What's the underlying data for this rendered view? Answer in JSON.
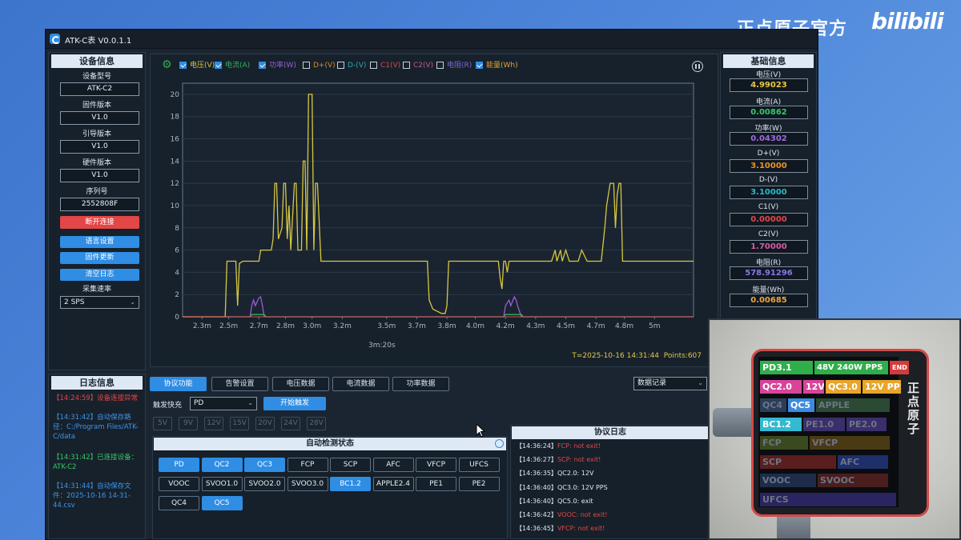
{
  "colors": {
    "voltage": "#d6c742",
    "current": "#2fb35a",
    "power": "#9b5bd9",
    "accent": "#2f8de4",
    "danger": "#e34646"
  },
  "window": {
    "title": "ATK-C表 V0.0.1.1"
  },
  "device_info": {
    "header": "设备信息",
    "fields": [
      {
        "label": "设备型号",
        "value": "ATK-C2"
      },
      {
        "label": "固件版本",
        "value": "V1.0"
      },
      {
        "label": "引导版本",
        "value": "V1.0"
      },
      {
        "label": "硬件版本",
        "value": "V1.0"
      },
      {
        "label": "序列号",
        "value": "2552808F"
      }
    ],
    "disconnect_label": "断开连接",
    "language_label": "语言设置",
    "firmware_update_label": "固件更新",
    "clear_log_label": "清空日志",
    "rate_label": "采集速率",
    "rate_value": "2 SPS"
  },
  "legend": [
    {
      "label": "电压(V)",
      "checked": true,
      "color": "#d6c742"
    },
    {
      "label": "电流(A)",
      "checked": true,
      "color": "#2fb35a"
    },
    {
      "label": "功率(W)",
      "checked": true,
      "color": "#9b5bd9"
    },
    {
      "label": "D+(V)",
      "checked": false,
      "color": "#d68a2a"
    },
    {
      "label": "D-(V)",
      "checked": false,
      "color": "#2aa8b8"
    },
    {
      "label": "C1(V)",
      "checked": false,
      "color": "#d84a4a"
    },
    {
      "label": "C2(V)",
      "checked": false,
      "color": "#c9569a"
    },
    {
      "label": "电阻(R)",
      "checked": false,
      "color": "#7d6bd6"
    },
    {
      "label": "能量(Wh)",
      "checked": true,
      "color": "#e3a335"
    }
  ],
  "chart_data": {
    "type": "line",
    "x_unit": "min",
    "xlim": [
      2.12,
      5.0
    ],
    "ylim": [
      0,
      21
    ],
    "y_ticks": [
      0,
      2,
      4,
      6,
      8,
      10,
      12,
      14,
      16,
      18,
      20
    ],
    "x_ticks": [
      "2.3m",
      "2.5m",
      "2.7m",
      "2.8m",
      "3.0m",
      "3.2m",
      "3.5m",
      "3.7m",
      "3.8m",
      "4.0m",
      "4.2m",
      "4.3m",
      "4.5m",
      "4.7m",
      "4.8m",
      "5m"
    ],
    "x_tick_values": [
      2.23,
      2.38,
      2.55,
      2.7,
      2.85,
      3.02,
      3.27,
      3.44,
      3.61,
      3.77,
      3.94,
      4.11,
      4.28,
      4.45,
      4.61,
      4.78
    ],
    "x_center_label": "3m:20s",
    "series": [
      {
        "name": "电压(V)",
        "points": [
          [
            2.12,
            0
          ],
          [
            2.36,
            0
          ],
          [
            2.37,
            5
          ],
          [
            2.42,
            5
          ],
          [
            2.43,
            1
          ],
          [
            2.44,
            4.8
          ],
          [
            2.46,
            5
          ],
          [
            2.55,
            5
          ],
          [
            2.56,
            6
          ],
          [
            2.62,
            6
          ],
          [
            2.63,
            7
          ],
          [
            2.64,
            12
          ],
          [
            2.65,
            12
          ],
          [
            2.66,
            7
          ],
          [
            2.68,
            8
          ],
          [
            2.69,
            12
          ],
          [
            2.7,
            12
          ],
          [
            2.71,
            7
          ],
          [
            2.72,
            10
          ],
          [
            2.73,
            6
          ],
          [
            2.75,
            12
          ],
          [
            2.76,
            12
          ],
          [
            2.77,
            6
          ],
          [
            2.79,
            6
          ],
          [
            2.8,
            14
          ],
          [
            2.81,
            14
          ],
          [
            2.82,
            6
          ],
          [
            2.83,
            20
          ],
          [
            2.85,
            20
          ],
          [
            2.86,
            6
          ],
          [
            2.87,
            12
          ],
          [
            2.88,
            12
          ],
          [
            2.9,
            5
          ],
          [
            3.5,
            5
          ],
          [
            3.51,
            1.5
          ],
          [
            3.53,
            0.7
          ],
          [
            3.58,
            0.3
          ],
          [
            3.6,
            0.3
          ],
          [
            3.61,
            1
          ],
          [
            3.62,
            5
          ],
          [
            3.9,
            5
          ],
          [
            3.91,
            3.5
          ],
          [
            3.92,
            2.5
          ],
          [
            3.93,
            5
          ],
          [
            3.94,
            5
          ],
          [
            3.95,
            4
          ],
          [
            3.96,
            5
          ],
          [
            4.2,
            5
          ],
          [
            4.22,
            6
          ],
          [
            4.23,
            5
          ],
          [
            4.25,
            6
          ],
          [
            4.26,
            5
          ],
          [
            4.28,
            6
          ],
          [
            4.3,
            5
          ],
          [
            4.35,
            5
          ],
          [
            4.37,
            6
          ],
          [
            4.4,
            5
          ],
          [
            4.48,
            5
          ],
          [
            4.5,
            8
          ],
          [
            4.51,
            10
          ],
          [
            4.53,
            12
          ],
          [
            4.55,
            12
          ],
          [
            4.56,
            8
          ],
          [
            4.57,
            11
          ],
          [
            4.58,
            12
          ],
          [
            4.59,
            12
          ],
          [
            4.6,
            5
          ],
          [
            5.0,
            5
          ]
        ]
      },
      {
        "name": "电流(A)",
        "points": [
          [
            2.12,
            0
          ],
          [
            2.5,
            0
          ],
          [
            2.51,
            0.2
          ],
          [
            2.58,
            0.2
          ],
          [
            2.59,
            0
          ],
          [
            3.93,
            0
          ],
          [
            3.94,
            0.2
          ],
          [
            4.03,
            0.2
          ],
          [
            4.04,
            0
          ],
          [
            5.0,
            0
          ]
        ]
      },
      {
        "name": "功率(W)",
        "points": [
          [
            2.12,
            0
          ],
          [
            2.5,
            0
          ],
          [
            2.51,
            1
          ],
          [
            2.52,
            1.5
          ],
          [
            2.53,
            1
          ],
          [
            2.55,
            1.7
          ],
          [
            2.56,
            1.8
          ],
          [
            2.57,
            1
          ],
          [
            2.58,
            0
          ],
          [
            3.93,
            0
          ],
          [
            3.94,
            1
          ],
          [
            3.96,
            1.5
          ],
          [
            3.97,
            1
          ],
          [
            3.99,
            1.8
          ],
          [
            4.0,
            1.5
          ],
          [
            4.01,
            0.9
          ],
          [
            4.03,
            0
          ],
          [
            5.0,
            0
          ]
        ]
      }
    ]
  },
  "chart_status": {
    "time": "T=2025-10-16 14:31:44",
    "points": "Points:607"
  },
  "basic_info": {
    "header": "基础信息",
    "fields": [
      {
        "label": "电压(V)",
        "value": "4.99023",
        "color": "#e8c840"
      },
      {
        "label": "电流(A)",
        "value": "0.00862",
        "color": "#35c86a"
      },
      {
        "label": "功率(W)",
        "value": "0.04302",
        "color": "#a467e0"
      },
      {
        "label": "D+(V)",
        "value": "3.10000",
        "color": "#e8932c"
      },
      {
        "label": "D-(V)",
        "value": "3.10000",
        "color": "#2ab9c6"
      },
      {
        "label": "C1(V)",
        "value": "0.00000",
        "color": "#e04848"
      },
      {
        "label": "C2(V)",
        "value": "1.70000",
        "color": "#d85ca4"
      },
      {
        "label": "电阻(R)",
        "value": "578.91296",
        "color": "#8a77e6"
      },
      {
        "label": "能量(Wh)",
        "value": "0.00685",
        "color": "#eca63a"
      }
    ]
  },
  "log": {
    "header": "日志信息",
    "entries": [
      {
        "text": "【14:24:59】设备连接异常",
        "color": "#e34646"
      },
      {
        "text": "【14:31:42】自动保存路径：C:/Program Files/ATK-C/data",
        "color": "#3c95ea"
      },
      {
        "text": "【14:31:42】已连接设备：ATK-C2",
        "color": "#35c86a"
      },
      {
        "text": "【14:31:44】自动保存文件：2025-10-16 14-31-44.csv",
        "color": "#3c95ea"
      }
    ]
  },
  "tabs": [
    "协议功能",
    "告警设置",
    "电压数据",
    "电流数据",
    "功率数据"
  ],
  "data_record_label": "数据记录",
  "trigger": {
    "label": "触发快充",
    "selected": "PD",
    "start_label": "开始触发",
    "voltages": [
      "5V",
      "9V",
      "12V",
      "15V",
      "20V",
      "24V",
      "28V"
    ]
  },
  "auto_detect": {
    "header": "自动检测状态",
    "protocols": [
      {
        "name": "PD",
        "on": true
      },
      {
        "name": "QC2",
        "on": true
      },
      {
        "name": "QC3",
        "on": true
      },
      {
        "name": "FCP",
        "on": false
      },
      {
        "name": "SCP",
        "on": false
      },
      {
        "name": "AFC",
        "on": false
      },
      {
        "name": "VFCP",
        "on": false
      },
      {
        "name": "UFCS",
        "on": false
      },
      {
        "name": "VOOC",
        "on": false
      },
      {
        "name": "SVOO1.0",
        "on": false
      },
      {
        "name": "SVOO2.0",
        "on": false
      },
      {
        "name": "SVOO3.0",
        "on": false
      },
      {
        "name": "BC1.2",
        "on": true
      },
      {
        "name": "APPLE2.4",
        "on": false
      },
      {
        "name": "PE1",
        "on": false
      },
      {
        "name": "PE2",
        "on": false
      },
      {
        "name": "QC4",
        "on": false
      },
      {
        "name": "QC5",
        "on": true
      }
    ]
  },
  "protocol_log": {
    "header": "协议日志",
    "entries": [
      {
        "time": "【14:36:24】",
        "text": "FCP:  not exit!",
        "color": "#e34646"
      },
      {
        "time": "【14:36:27】",
        "text": "SCP:  not exit!",
        "color": "#e34646"
      },
      {
        "time": "【14:36:35】",
        "text": "QC2.0:  12V",
        "color": "#dfe7ef"
      },
      {
        "time": "【14:36:40】",
        "text": "QC3.0:  12V PPS",
        "color": "#dfe7ef"
      },
      {
        "time": "【14:36:40】",
        "text": "QC5.0:  exit",
        "color": "#dfe7ef"
      },
      {
        "time": "【14:36:42】",
        "text": "VOOC:  not exit!",
        "color": "#e34646"
      },
      {
        "time": "【14:36:45】",
        "text": "VFCP:  not exit!",
        "color": "#e34646"
      }
    ]
  },
  "device_screen": {
    "brand": "正点原子",
    "rows": [
      [
        {
          "text": "PD3.1",
          "bg": "#2fae4a"
        },
        {
          "text": "48V 240W PPS",
          "bg": "#2fae4a"
        },
        {
          "text": "END",
          "bg": "#d43b3b"
        }
      ],
      [
        {
          "text": "QC2.0",
          "bg": "#d8449a"
        },
        {
          "text": "12V",
          "bg": "#d8449a"
        },
        {
          "text": "QC3.0",
          "bg": "#e8a52a"
        },
        {
          "text": "12V PPS",
          "bg": "#e8a52a"
        }
      ],
      [
        {
          "text": "QC4",
          "bg": "#2a3d5a"
        },
        {
          "text": "QC5",
          "bg": "#3b8be0"
        },
        {
          "text": "APPLE",
          "bg": "#2a4a33"
        }
      ],
      [
        {
          "text": "BC1.2",
          "bg": "#33b9d2"
        },
        {
          "text": "PE1.0",
          "bg": "#3a2f6a"
        },
        {
          "text": "PE2.0",
          "bg": "#3a2f6a"
        }
      ],
      [
        {
          "text": "FCP",
          "bg": "#3b4a1e"
        },
        {
          "text": "VFCP",
          "bg": "#4a3a14"
        }
      ],
      [
        {
          "text": "SCP",
          "bg": "#5a1e1e"
        },
        {
          "text": "AFC",
          "bg": "#1e2f6a"
        }
      ],
      [
        {
          "text": "VOOC",
          "bg": "#1d2c4a"
        },
        {
          "text": "SVOOC",
          "bg": "#4a1e1e"
        }
      ],
      [
        {
          "text": "UFCS",
          "bg": "#2a2560"
        }
      ]
    ]
  },
  "watermark": {
    "channel": "正点原子官方",
    "site": "bilibili"
  }
}
